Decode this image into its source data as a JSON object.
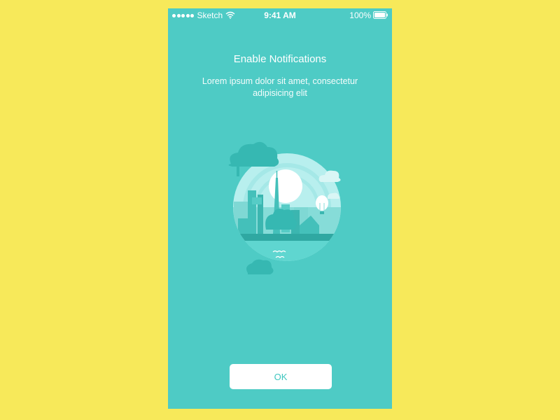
{
  "status_bar": {
    "carrier": "Sketch",
    "time": "9:41 AM",
    "battery": "100%"
  },
  "screen": {
    "title": "Enable Notifications",
    "subtitle": "Lorem ipsum dolor sit amet, consectetur adipisicing elit",
    "ok_label": "OK",
    "illustration_icon": "city-illustration-icon"
  },
  "colors": {
    "page_background": "#f7e95a",
    "screen_background": "#4ecbc5",
    "button_background": "#ffffff",
    "button_text": "#3ec6bf"
  }
}
